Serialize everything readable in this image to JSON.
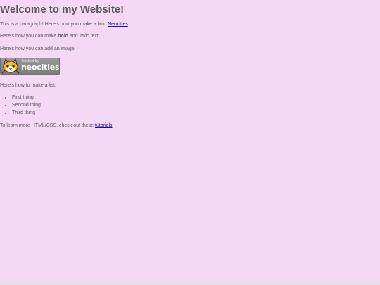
{
  "header": {
    "title": "Welcome to my Website!"
  },
  "intro": {
    "text_before_link": "This is a paragraph! Here's how you make a link: ",
    "link_text": "Neocities",
    "text_after_link": "."
  },
  "formatting": {
    "text_before_bold": "Here's how you can make ",
    "bold_text": "bold",
    "text_between": " and ",
    "italic_text": "italic",
    "text_after": " text."
  },
  "image_section": {
    "label": "Here's how you can add an image:",
    "badge": {
      "hosted_by": "hosted by",
      "brand": "neocities",
      "icon": "cat-mascot-icon"
    }
  },
  "list_section": {
    "label": "Here's how to make a list:",
    "items": [
      "First thing",
      "Second thing",
      "Third thing"
    ]
  },
  "footer": {
    "text_before_link": "To learn more HTML/CSS, check out these ",
    "link_text": "tutorials",
    "text_after_link": "!"
  },
  "colors": {
    "background": "#f4d8f6",
    "link": "#1a0dab",
    "text": "#5c5c5c"
  }
}
